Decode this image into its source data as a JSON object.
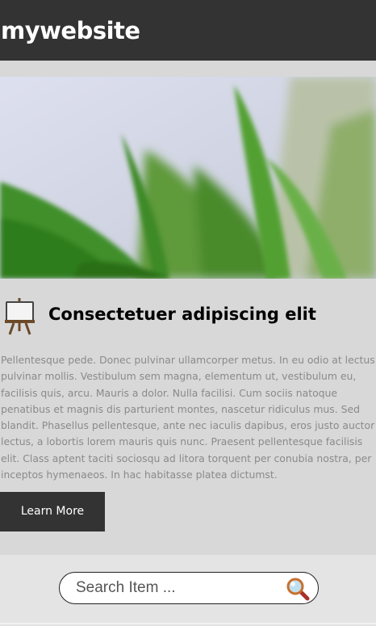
{
  "header": {
    "site_title": "mywebsite"
  },
  "hero": {
    "image": "blurred-green-leaves"
  },
  "article": {
    "icon": "easel-icon",
    "heading": "Consectetuer adipiscing elit",
    "body": "Pellentesque pede. Donec pulvinar ullamcorper metus. In eu odio at lectus pulvinar mollis. Vestibulum sem magna, elementum ut, vestibulum eu, facilisis quis, arcu. Mauris a dolor. Nulla facilisi. Cum sociis natoque penatibus et magnis dis parturient montes, nascetur ridiculus mus. Sed blandit. Phasellus pellentesque, ante nec iaculis dapibus, eros justo auctor lectus, a lobortis lorem mauris quis nunc. Praesent pellentesque facilisis elit. Class aptent taciti sociosqu ad litora torquent per conubia nostra, per inceptos hymenaeos. In hac habitasse platea dictumst.",
    "button_label": "Learn More"
  },
  "search": {
    "placeholder": "Search Item ...",
    "value": "",
    "icon": "magnifier-icon"
  },
  "colors": {
    "header_bg": "#333333",
    "button_bg": "#333333",
    "body_text": "#8a8a8a"
  }
}
